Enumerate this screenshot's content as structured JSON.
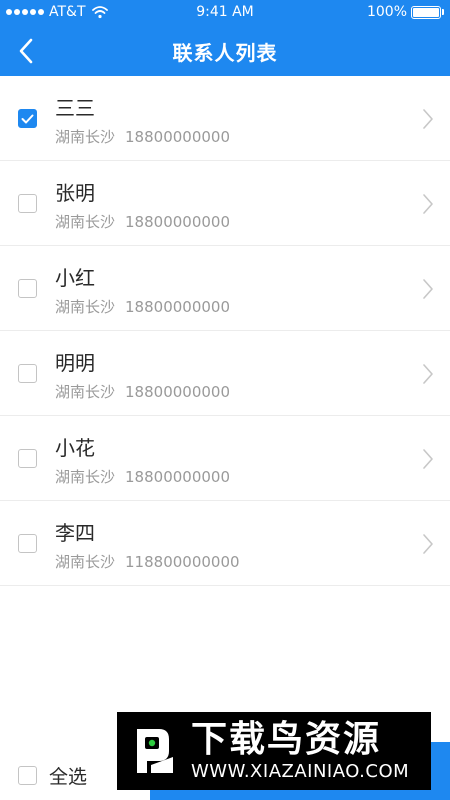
{
  "status_bar": {
    "carrier": "AT&T",
    "time": "9:41 AM",
    "battery": "100%"
  },
  "nav": {
    "title": "联系人列表"
  },
  "contacts": [
    {
      "name": "三三",
      "location": "湖南长沙",
      "phone": "18800000000",
      "checked": true
    },
    {
      "name": "张明",
      "location": "湖南长沙",
      "phone": "18800000000",
      "checked": false
    },
    {
      "name": "小红",
      "location": "湖南长沙",
      "phone": "18800000000",
      "checked": false
    },
    {
      "name": "明明",
      "location": "湖南长沙",
      "phone": "18800000000",
      "checked": false
    },
    {
      "name": "小花",
      "location": "湖南长沙",
      "phone": "18800000000",
      "checked": false
    },
    {
      "name": "李四",
      "location": "湖南长沙",
      "phone": "118800000000",
      "checked": false
    }
  ],
  "footer": {
    "select_all_label": "全选"
  },
  "watermark": {
    "title": "下载鸟资源",
    "url": "WWW.XIAZAINIAO.COM"
  },
  "colors": {
    "primary": "#1e88f0",
    "text": "#2a2a2a",
    "subtext": "#9a9a9a"
  }
}
